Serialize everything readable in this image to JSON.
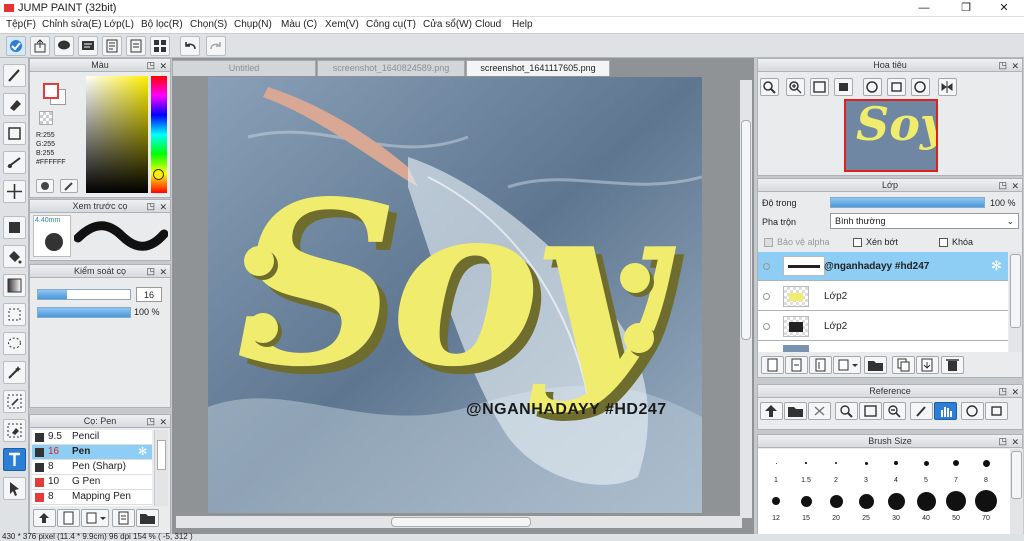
{
  "app": {
    "title": "JUMP PAINT (32bit)"
  },
  "window_controls": {
    "minimize": "—",
    "maximize": "❐",
    "close": "✕"
  },
  "menu": [
    "Tệp(F)",
    "Chỉnh sửa(E)",
    "Lớp(L)",
    "Bộ lọc(R)",
    "Chọn(S)",
    "Chụp(N)",
    "Màu (C)",
    "Xem(V)",
    "Công cụ(T)",
    "Cửa sổ(W)",
    "Cloud",
    "Help"
  ],
  "color_panel": {
    "title": "Màu",
    "r": "R:255",
    "g": "G:255",
    "b": "B:255",
    "hex": "#FFFFFF"
  },
  "brush_preview": {
    "title": "Xem trước cọ",
    "size": "4.40mm"
  },
  "brush_control": {
    "title": "Kiểm soát cọ",
    "size_value": "16",
    "opacity_value": "100 %"
  },
  "brush_list": {
    "title": "Cọ: Pen",
    "items": [
      {
        "size": "9.5",
        "name": "Pencil",
        "selected": false,
        "color": "#333333"
      },
      {
        "size": "16",
        "name": "Pen",
        "selected": true,
        "color": "#333333"
      },
      {
        "size": "8",
        "name": "Pen (Sharp)",
        "selected": false,
        "color": "#333333"
      },
      {
        "size": "10",
        "name": "G Pen",
        "selected": false,
        "color": "#e23b3b"
      },
      {
        "size": "8",
        "name": "Mapping Pen",
        "selected": false,
        "color": "#e23b3b"
      }
    ]
  },
  "tabs": [
    {
      "label": "Untitled",
      "active": false
    },
    {
      "label": "screenshot_1640824589.png",
      "active": false
    },
    {
      "label": "screenshot_1641117605.png",
      "active": true
    }
  ],
  "artwork": {
    "big_text": "Soy",
    "caption": "@NGANHADAYY #HD247"
  },
  "navigator": {
    "title": "Hoa tiêu"
  },
  "layers": {
    "title": "Lớp",
    "opacity_label": "Độ trong",
    "opacity_value": "100 %",
    "blend_label": "Pha trộn",
    "blend_value": "Bình thường",
    "protect_alpha": "Bảo vệ alpha",
    "clip": "Xén bớt",
    "lock": "Khóa",
    "items": [
      {
        "name": "@nganhadayy #hd247",
        "selected": true
      },
      {
        "name": "Lớp2",
        "selected": false
      },
      {
        "name": "Lớp2",
        "selected": false
      }
    ]
  },
  "reference": {
    "title": "Reference"
  },
  "brush_size": {
    "title": "Brush Size",
    "row1": [
      "1",
      "1.5",
      "2",
      "3",
      "4",
      "5",
      "7",
      "8",
      "10"
    ],
    "row2": [
      "12",
      "15",
      "20",
      "25",
      "30",
      "40",
      "50",
      "70"
    ]
  },
  "status": {
    "text": "430 * 376 pixel   (11.4 * 9.9cm)   96 dpi   154 %   ( -5, 312 )"
  },
  "colors": {
    "accent": "#2b7fd6",
    "selected_row": "#8ecdf4",
    "art_yellow": "#f0ec6e",
    "art_shadow": "#6f6d2d"
  }
}
